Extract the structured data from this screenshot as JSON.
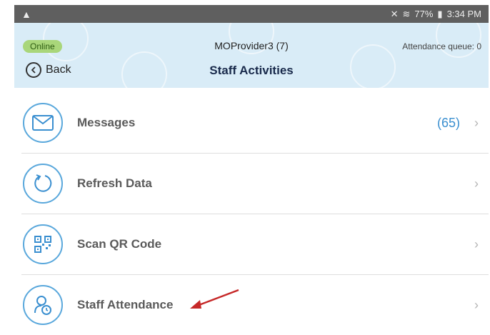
{
  "status_bar": {
    "warning_icon": "warning-icon",
    "battery": "77%",
    "time": "3:34 PM"
  },
  "header": {
    "status": "Online",
    "provider": "MOProvider3 (7)",
    "queue": "Attendance queue: 0",
    "back_label": "Back",
    "title": "Staff Activities"
  },
  "menu": {
    "items": [
      {
        "label": "Messages",
        "count": "(65)",
        "icon": "envelope-icon"
      },
      {
        "label": "Refresh Data",
        "count": "",
        "icon": "refresh-icon"
      },
      {
        "label": "Scan QR Code",
        "count": "",
        "icon": "qr-code-icon"
      },
      {
        "label": "Staff Attendance",
        "count": "",
        "icon": "staff-clock-icon"
      }
    ]
  },
  "colors": {
    "header_bg": "#d9ecf7",
    "accent": "#3a8fd0",
    "online": "#a9d67a",
    "annotation_arrow": "#c62828"
  }
}
